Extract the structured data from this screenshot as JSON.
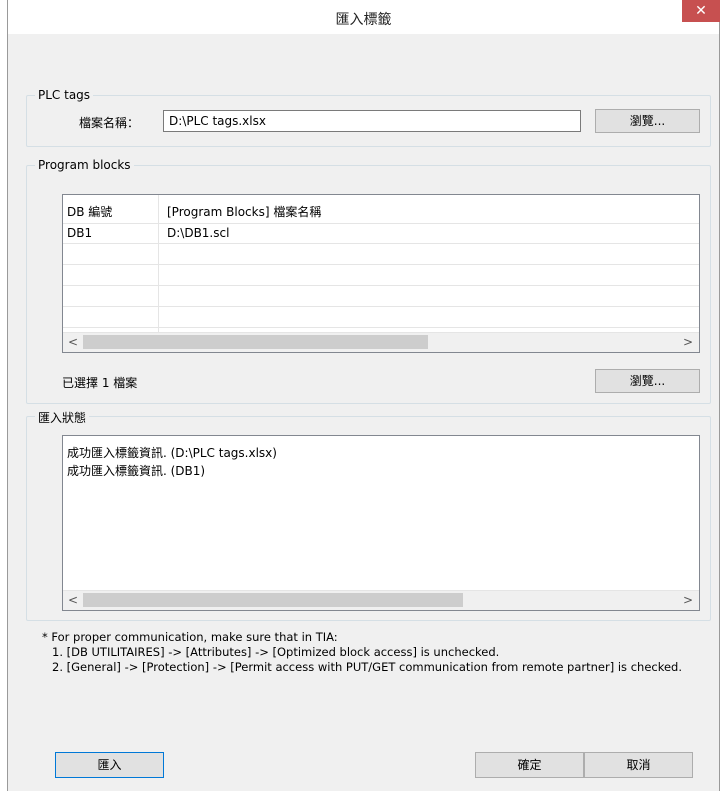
{
  "window": {
    "title": "匯入標籤",
    "close_label": "✕"
  },
  "plc_tags": {
    "group_label": "PLC tags",
    "file_label": "檔案名稱：",
    "file_value": "D:\\PLC tags.xlsx",
    "browse_label": "瀏覽..."
  },
  "program_blocks": {
    "group_label": "Program blocks",
    "columns": [
      "DB 編號",
      "[Program Blocks] 檔案名稱"
    ],
    "rows": [
      {
        "db": "DB1",
        "file": "D:\\DB1.scl"
      }
    ],
    "selected_text": "已選擇 1 檔案",
    "browse_label": "瀏覽..."
  },
  "import_status": {
    "group_label": "匯入狀態",
    "lines": [
      "成功匯入標籤資訊. (D:\\PLC tags.xlsx)",
      "成功匯入標籤資訊. (DB1)"
    ]
  },
  "notes": {
    "line1": "* For proper communication, make sure that in TIA:",
    "line2": "1. [DB UTILITAIRES] -> [Attributes] -> [Optimized block access] is unchecked.",
    "line3": "2. [General] -> [Protection] -> [Permit access with PUT/GET communication from remote partner] is checked."
  },
  "buttons": {
    "import": "匯入",
    "ok": "確定",
    "cancel": "取消"
  },
  "scroll": {
    "left": "<",
    "right": ">"
  }
}
